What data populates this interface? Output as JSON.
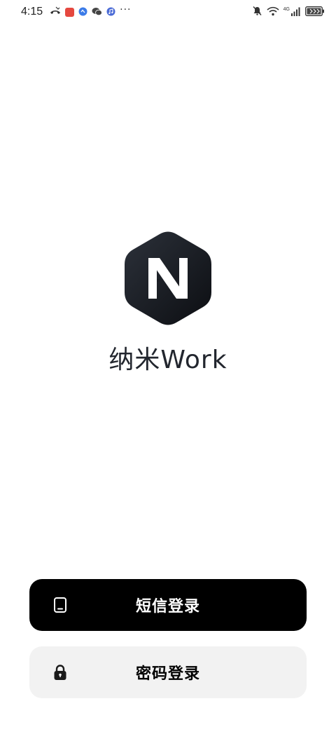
{
  "status_bar": {
    "time": "4:15",
    "network_label": "4G",
    "more_indicator": "···",
    "icons": [
      "missed-call-icon",
      "app-notification-red-icon",
      "app-notification-blue-icon",
      "wechat-icon",
      "music-icon",
      "mute-bell-icon",
      "wifi-icon",
      "signal-icon",
      "battery-icon"
    ],
    "colors": {
      "red_app": "#e5483f",
      "blue_app": "#3b7be8",
      "music_app": "#4b6bd6"
    }
  },
  "app": {
    "name": "纳米Work",
    "logo_icon": "nano-n-hexagon-logo-icon"
  },
  "buttons": {
    "sms_login": {
      "label": "短信登录",
      "icon": "phone-icon"
    },
    "password_login": {
      "label": "密码登录",
      "icon": "lock-icon"
    }
  },
  "colors": {
    "primary_button": "#000000",
    "secondary_button": "#f2f2f2",
    "logo_dark": "#1c2028"
  }
}
